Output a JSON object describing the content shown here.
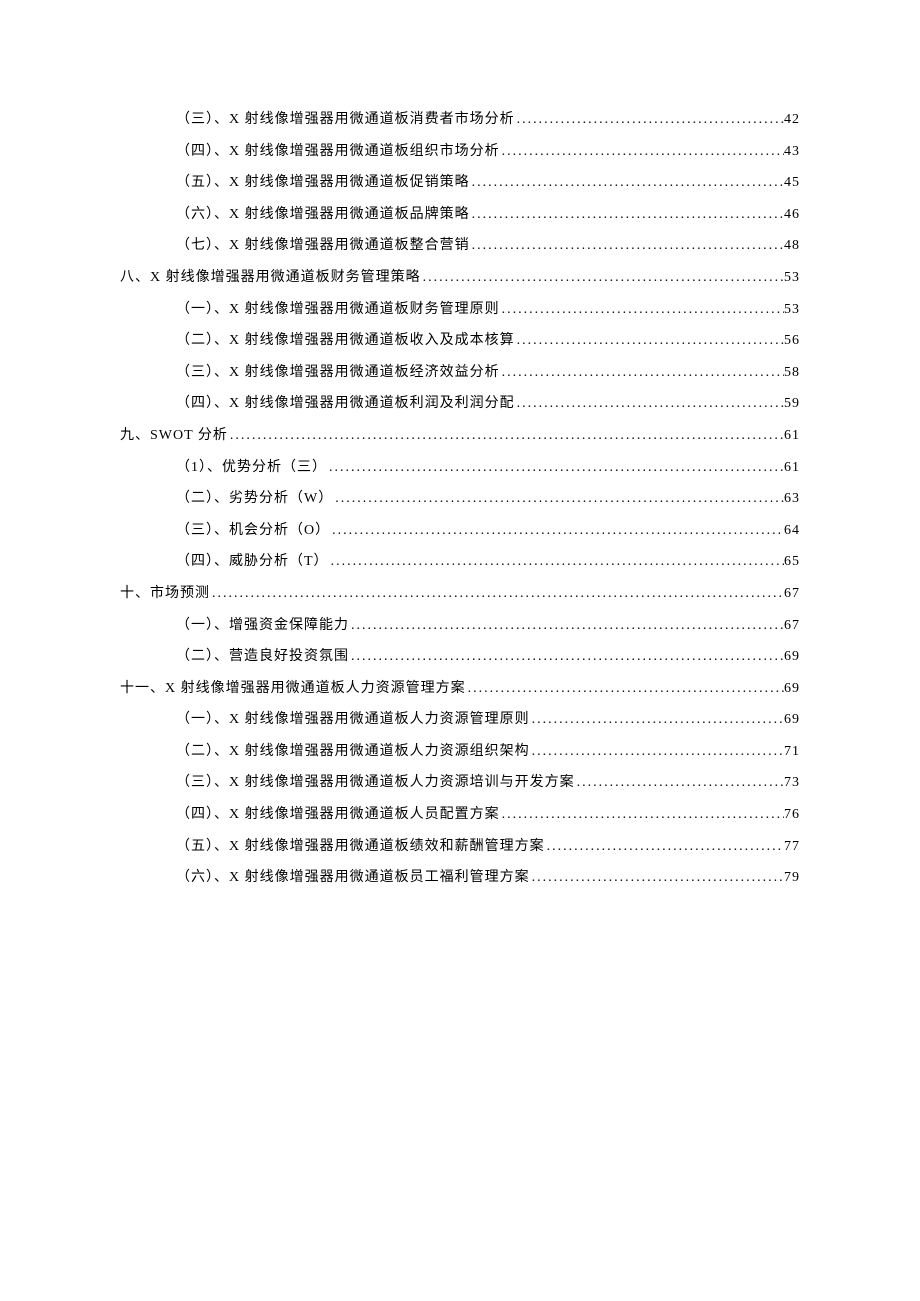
{
  "toc": [
    {
      "level": "sub",
      "title": "（三）、X 射线像增强器用微通道板消费者市场分析",
      "page": "42"
    },
    {
      "level": "sub",
      "title": "（四）、X 射线像增强器用微通道板组织市场分析",
      "page": "43"
    },
    {
      "level": "sub",
      "title": "（五）、X 射线像增强器用微通道板促销策略",
      "page": "45"
    },
    {
      "level": "sub",
      "title": "（六）、X 射线像增强器用微通道板品牌策略",
      "page": "46"
    },
    {
      "level": "sub",
      "title": "（七）、X 射线像增强器用微通道板整合营销",
      "page": "48"
    },
    {
      "level": "top",
      "title": "八、X 射线像增强器用微通道板财务管理策略",
      "page": "53"
    },
    {
      "level": "sub",
      "title": "（一）、X 射线像增强器用微通道板财务管理原则",
      "page": "53"
    },
    {
      "level": "sub",
      "title": "（二）、X 射线像增强器用微通道板收入及成本核算",
      "page": "56"
    },
    {
      "level": "sub",
      "title": "（三）、X 射线像增强器用微通道板经济效益分析",
      "page": "58"
    },
    {
      "level": "sub",
      "title": "（四）、X 射线像增强器用微通道板利润及利润分配",
      "page": "59"
    },
    {
      "level": "top",
      "title": "九、SWOT 分析",
      "page": "61"
    },
    {
      "level": "sub",
      "title": "（1）、优势分析（三）",
      "page": "61"
    },
    {
      "level": "sub",
      "title": "（二）、劣势分析（W）",
      "page": "63"
    },
    {
      "level": "sub",
      "title": "（三）、机会分析（O）",
      "page": "64"
    },
    {
      "level": "sub",
      "title": "（四）、威胁分析（T）",
      "page": "65"
    },
    {
      "level": "top",
      "title": "十、市场预测",
      "page": "67"
    },
    {
      "level": "sub",
      "title": "（一）、增强资金保障能力",
      "page": "67"
    },
    {
      "level": "sub",
      "title": "（二）、营造良好投资氛围",
      "page": "69"
    },
    {
      "level": "top",
      "title": "十一、X 射线像增强器用微通道板人力资源管理方案",
      "page": "69"
    },
    {
      "level": "sub",
      "title": "（一）、X 射线像增强器用微通道板人力资源管理原则",
      "page": "69"
    },
    {
      "level": "sub",
      "title": "（二）、X 射线像增强器用微通道板人力资源组织架构",
      "page": "71"
    },
    {
      "level": "sub",
      "title": "（三）、X 射线像增强器用微通道板人力资源培训与开发方案",
      "page": "73"
    },
    {
      "level": "sub",
      "title": "（四）、X 射线像增强器用微通道板人员配置方案",
      "page": "76"
    },
    {
      "level": "sub",
      "title": "（五）、X 射线像增强器用微通道板绩效和薪酬管理方案",
      "page": "77"
    },
    {
      "level": "sub",
      "title": "（六）、X 射线像增强器用微通道板员工福利管理方案",
      "page": "79"
    }
  ]
}
